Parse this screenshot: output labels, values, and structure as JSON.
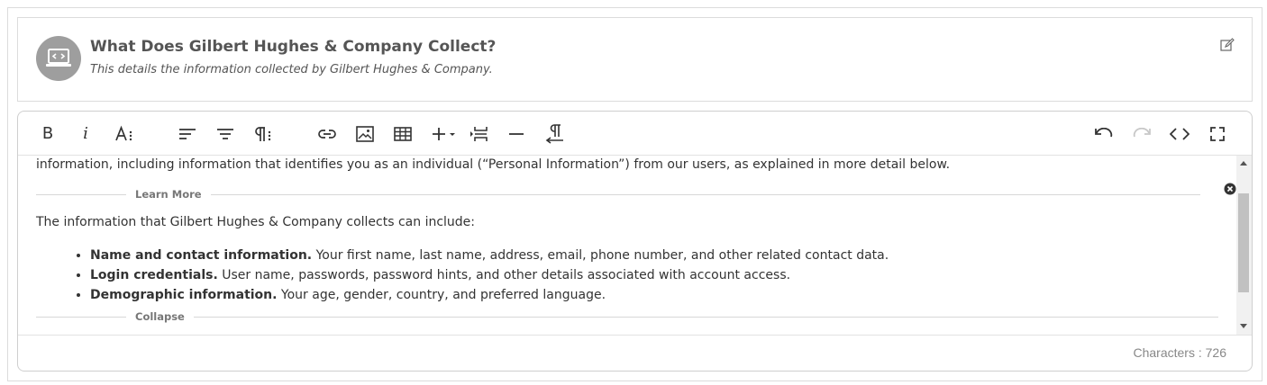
{
  "header": {
    "title": "What Does Gilbert Hughes & Company Collect?",
    "subtitle": "This details the information collected by Gilbert Hughes & Company.",
    "avatar_icon": "laptop-code-icon",
    "edit_icon": "edit-icon"
  },
  "toolbar": {
    "left_buttons": [
      "bold",
      "italic",
      "font-size",
      "align",
      "paragraph-format",
      "paragraph-style",
      "insert-link",
      "insert-image",
      "insert-table",
      "more-insert",
      "insert-page-break",
      "insert-horizontal-line",
      "clear-formatting"
    ],
    "bold_label": "B",
    "italic_label": "i",
    "right_buttons": [
      "undo",
      "redo",
      "code-view",
      "fullscreen"
    ],
    "redo_disabled": true
  },
  "content": {
    "intro_text": "information, including information that identifies you as an individual (“Personal Information”) from our users, as explained in more detail below.",
    "learn_more_label": "Learn More",
    "collect_text": "The information that Gilbert Hughes & Company collects can include:",
    "items": [
      {
        "bold": "Name and contact information.",
        "text": " Your first name, last name, address, email, phone number, and other related contact data."
      },
      {
        "bold": "Login credentials.",
        "text": " User name, passwords, password hints, and other details associated with account access."
      },
      {
        "bold": "Demographic information.",
        "text": " Your age, gender, country, and preferred language."
      }
    ],
    "collapse_label": "Collapse"
  },
  "footer": {
    "char_count": "Characters : 726"
  }
}
